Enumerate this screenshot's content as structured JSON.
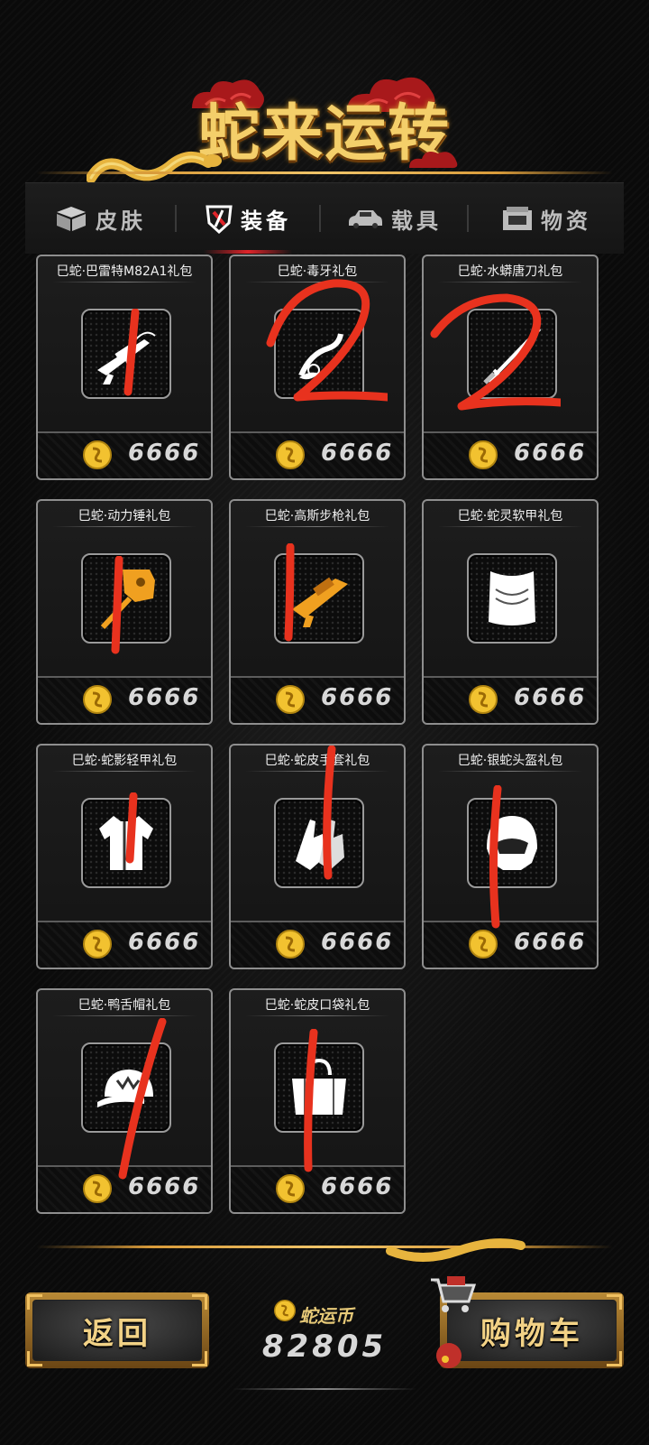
{
  "header": {
    "title": "蛇来运转"
  },
  "tabs": [
    {
      "label": "皮肤",
      "icon": "box-icon",
      "active": false
    },
    {
      "label": "装备",
      "icon": "shield-icon",
      "active": true
    },
    {
      "label": "载具",
      "icon": "car-icon",
      "active": false
    },
    {
      "label": "物资",
      "icon": "supply-crate-icon",
      "active": false
    }
  ],
  "items": [
    {
      "name": "巳蛇·巴雷特M82A1礼包",
      "price": "6666",
      "icon": "sniper-rifle-icon",
      "icon_color": "#ffffff"
    },
    {
      "name": "巳蛇·毒牙礼包",
      "price": "6666",
      "icon": "fang-weapon-icon",
      "icon_color": "#ffffff"
    },
    {
      "name": "巳蛇·水蟒唐刀礼包",
      "price": "6666",
      "icon": "katana-icon",
      "icon_color": "#ffffff"
    },
    {
      "name": "巳蛇·动力锤礼包",
      "price": "6666",
      "icon": "hammer-icon",
      "icon_color": "#f0a020"
    },
    {
      "name": "巳蛇·高斯步枪礼包",
      "price": "6666",
      "icon": "gauss-rifle-icon",
      "icon_color": "#f0a020"
    },
    {
      "name": "巳蛇·蛇灵软甲礼包",
      "price": "6666",
      "icon": "vest-icon",
      "icon_color": "#ffffff"
    },
    {
      "name": "巳蛇·蛇影轻甲礼包",
      "price": "6666",
      "icon": "light-armor-icon",
      "icon_color": "#ffffff"
    },
    {
      "name": "巳蛇·蛇皮手套礼包",
      "price": "6666",
      "icon": "gloves-icon",
      "icon_color": "#ffffff"
    },
    {
      "name": "巳蛇·银蛇头盔礼包",
      "price": "6666",
      "icon": "helmet-icon",
      "icon_color": "#ffffff"
    },
    {
      "name": "巳蛇·鸭舌帽礼包",
      "price": "6666",
      "icon": "cap-icon",
      "icon_color": "#ffffff"
    },
    {
      "name": "巳蛇·蛇皮口袋礼包",
      "price": "6666",
      "icon": "bag-icon",
      "icon_color": "#ffffff"
    }
  ],
  "annotations": [
    "1",
    "2",
    "2",
    "1",
    "1",
    "",
    "1",
    "1",
    "1",
    "1",
    "1"
  ],
  "annotation_color": "#e8321e",
  "footer": {
    "back_label": "返回",
    "currency_label": "蛇运币",
    "currency_value": "82805",
    "cart_label": "购物车"
  },
  "colors": {
    "gold": "#f4cf6a",
    "tab_active_underline": "#e0242a",
    "coin": "#f2c230"
  }
}
